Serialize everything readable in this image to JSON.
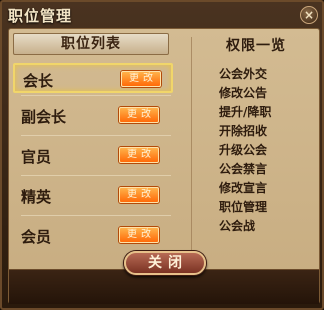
{
  "window": {
    "title": "职位管理",
    "close_icon": "×"
  },
  "left_panel": {
    "header": "职位列表",
    "button_label": "更改",
    "items": [
      {
        "name": "会长",
        "selected": true
      },
      {
        "name": "副会长",
        "selected": false
      },
      {
        "name": "官员",
        "selected": false
      },
      {
        "name": "精英",
        "selected": false
      },
      {
        "name": "会员",
        "selected": false
      }
    ]
  },
  "right_panel": {
    "header": "权限一览",
    "permissions": [
      "公会外交",
      "修改公告",
      "提升/降职",
      "开除招收",
      "升级公会",
      "公会禁言",
      "修改宣言",
      "职位管理",
      "公会战"
    ]
  },
  "footer": {
    "close_label": "关闭"
  },
  "colors": {
    "accent": "#ff6a08",
    "selection": "#f1d66a",
    "panel": "#c7ac80"
  }
}
